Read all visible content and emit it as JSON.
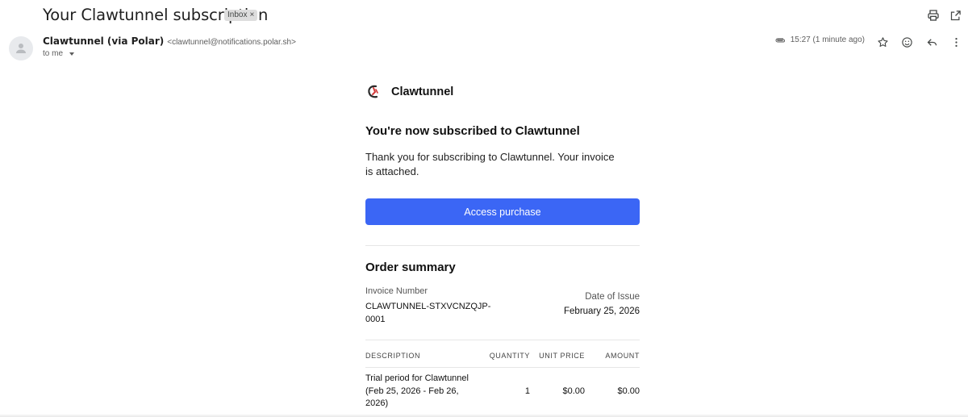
{
  "header": {
    "subject": "Your Clawtunnel subscription",
    "inbox_label": "Inbox",
    "print_icon": "print-icon",
    "open_new_icon": "open-in-new-window-icon"
  },
  "message": {
    "sender_name": "Clawtunnel (via Polar)",
    "sender_email": "<clawtunnel@notifications.polar.sh>",
    "to_label": "to me",
    "timestamp": "15:27 (1 minute ago)",
    "attachment_icon": "paperclip-icon",
    "star_icon": "star-icon",
    "emoji_icon": "emoji-icon",
    "reply_icon": "reply-icon",
    "more_icon": "more-vertical-icon"
  },
  "email": {
    "brand_name": "Clawtunnel",
    "heading": "You're now subscribed to Clawtunnel",
    "lead": "Thank you for subscribing to Clawtunnel. Your invoice is attached.",
    "cta_label": "Access purchase",
    "order_title": "Order summary",
    "invoice_label": "Invoice Number",
    "invoice_number": "CLAWTUNNEL-STXVCNZQJP-0001",
    "date_label": "Date of Issue",
    "date_value": "February 25, 2026",
    "columns": {
      "description": "DESCRIPTION",
      "quantity": "QUANTITY",
      "unit_price": "UNIT PRICE",
      "amount": "AMOUNT"
    },
    "items": [
      {
        "description": "Trial period for Clawtunnel (Feb 25, 2026 - Feb 26, 2026)",
        "quantity": "1",
        "unit_price": "$0.00",
        "amount": "$0.00"
      }
    ]
  },
  "colors": {
    "cta": "#3b66f5",
    "brand_mark_red": "#d23a3a",
    "brand_mark_dark": "#2b2b2b"
  }
}
